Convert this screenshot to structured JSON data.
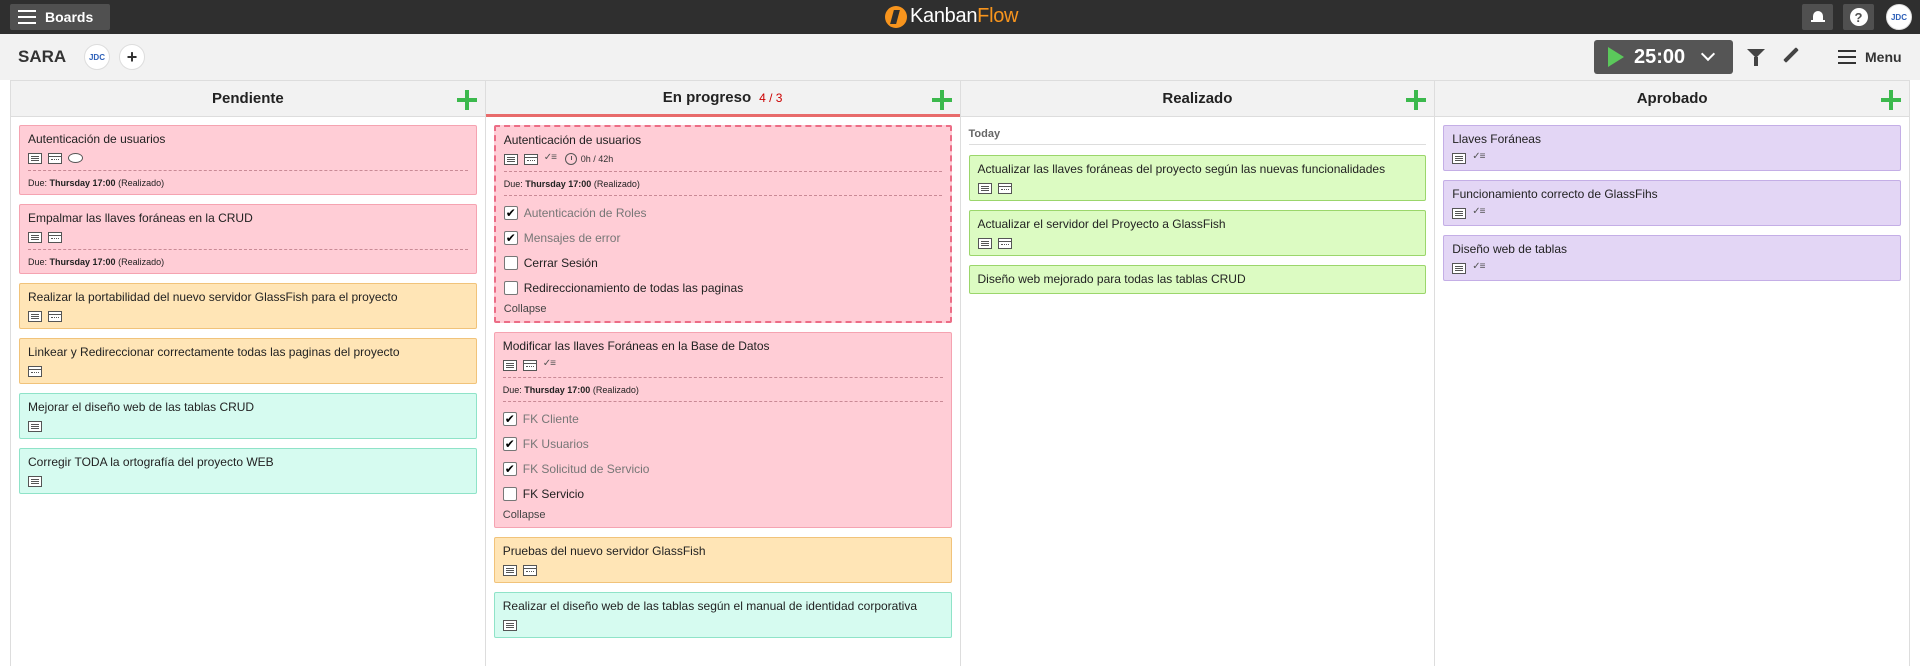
{
  "topbar": {
    "boards_label": "Boards",
    "logo_kanban": "Kanban",
    "logo_flow": "Flow",
    "help_label": "?",
    "user_initials": "JDC"
  },
  "boardbar": {
    "title": "SARA",
    "member_initials": "JDC",
    "add_label": "+",
    "timer": "25:00",
    "menu_label": "Menu"
  },
  "columns": [
    {
      "name": "Pendiente",
      "cards": [
        {
          "title": "Autenticación de usuarios",
          "due_prefix": "Due:",
          "due_day": "Thursday 17:00",
          "due_note": "(Realizado)"
        },
        {
          "title": "Empalmar las llaves foráneas en la CRUD",
          "due_prefix": "Due:",
          "due_day": "Thursday 17:00",
          "due_note": "(Realizado)"
        },
        {
          "title": "Realizar la portabilidad del nuevo servidor GlassFish para el proyecto"
        },
        {
          "title": "Linkear y Redireccionar correctamente todas las paginas del proyecto"
        },
        {
          "title": "Mejorar el diseño web de las tablas CRUD"
        },
        {
          "title": "Corregir TODA la ortografía del proyecto WEB"
        }
      ]
    },
    {
      "name": "En progreso",
      "wip": "4 / 3",
      "cards": [
        {
          "title": "Autenticación de usuarios",
          "time": "0h / 42h",
          "due_prefix": "Due:",
          "due_day": "Thursday 17:00",
          "due_note": "(Realizado)",
          "subtasks": [
            {
              "label": "Autenticación de Roles",
              "done": true
            },
            {
              "label": "Mensajes de error",
              "done": true
            },
            {
              "label": "Cerrar Sesión",
              "done": false
            },
            {
              "label": "Redireccionamiento de todas las paginas",
              "done": false
            }
          ],
          "collapse": "Collapse"
        },
        {
          "title": "Modificar las llaves Foráneas en la Base de Datos",
          "due_prefix": "Due:",
          "due_day": "Thursday 17:00",
          "due_note": "(Realizado)",
          "subtasks": [
            {
              "label": "FK Cliente",
              "done": true
            },
            {
              "label": "FK Usuarios",
              "done": true
            },
            {
              "label": "FK Solicitud de Servicio",
              "done": true
            },
            {
              "label": "FK Servicio",
              "done": false
            }
          ],
          "collapse": "Collapse"
        },
        {
          "title": "Pruebas del nuevo servidor GlassFish"
        },
        {
          "title": "Realizar el diseño web de las tablas según el manual de identidad corporativa"
        }
      ]
    },
    {
      "name": "Realizado",
      "group": "Today",
      "cards": [
        {
          "title": "Actualizar las llaves foráneas del proyecto según las nuevas funcionalidades"
        },
        {
          "title": "Actualizar el servidor del Proyecto a GlassFish"
        },
        {
          "title": "Diseño web mejorado para todas las tablas CRUD"
        }
      ]
    },
    {
      "name": "Aprobado",
      "cards": [
        {
          "title": "Llaves Foráneas"
        },
        {
          "title": "Funcionamiento correcto de GlassFihs"
        },
        {
          "title": "Diseño web de tablas"
        }
      ]
    }
  ],
  "colors": {
    "red_card": "#ffcdd6",
    "orange_card": "#ffe5b6",
    "teal_card": "#d6fbf0",
    "green_card": "#dcfbc2",
    "purple_card": "#e3d6f5",
    "add_green": "#3cb94d",
    "logo_orange": "#f7941d"
  },
  "icons": [
    "menu-icon",
    "bell-icon",
    "help-icon",
    "play-icon",
    "chevron-down-icon",
    "filter-icon",
    "pencil-icon",
    "plus-icon",
    "description-icon",
    "calendar-icon",
    "comment-icon",
    "checklist-icon",
    "clock-icon",
    "checkbox-icon"
  ]
}
